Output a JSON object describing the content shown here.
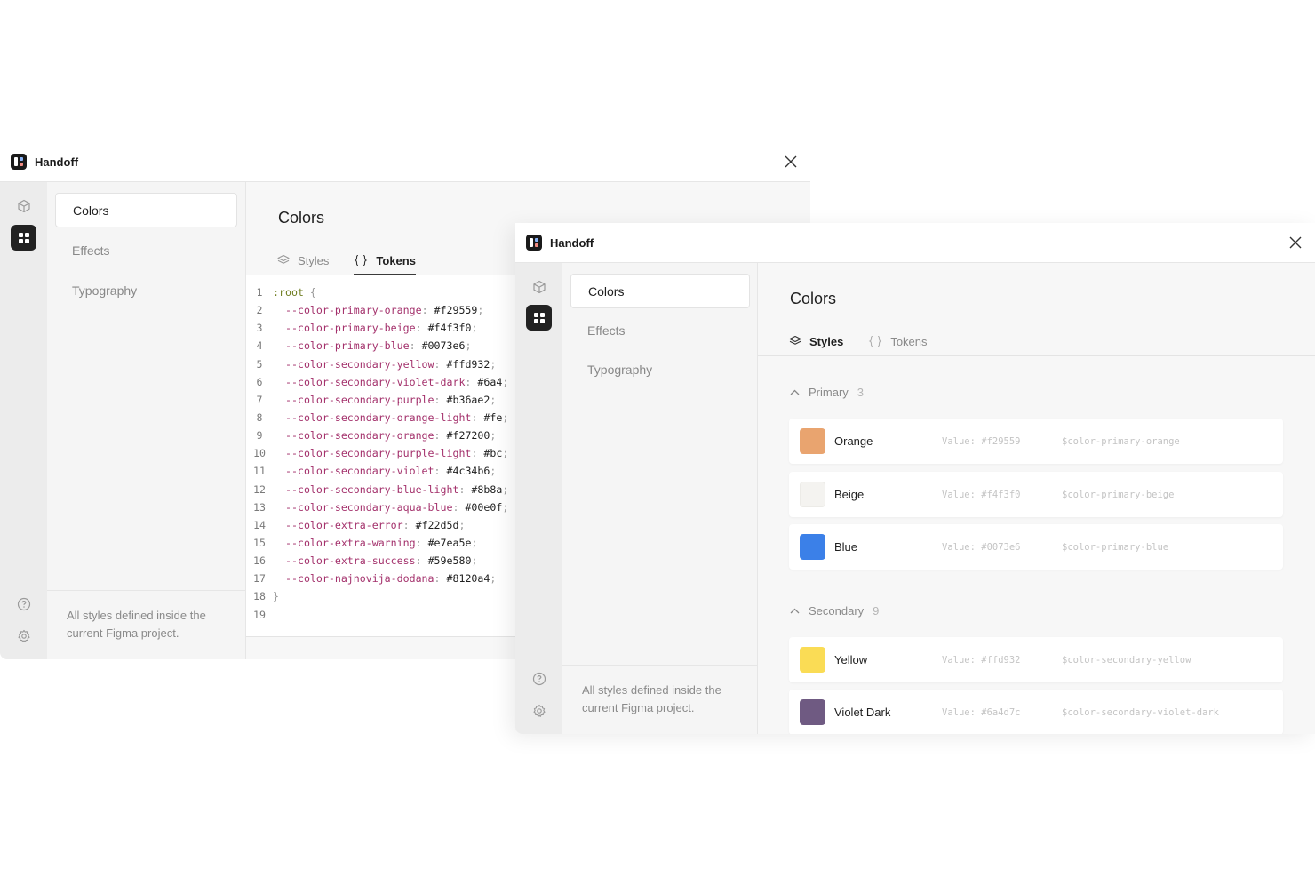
{
  "app": {
    "title": "Handoff"
  },
  "nav": {
    "items": [
      {
        "label": "Colors",
        "active": true
      },
      {
        "label": "Effects",
        "active": false
      },
      {
        "label": "Typography",
        "active": false
      }
    ],
    "footer": "All styles defined inside the current Figma project."
  },
  "main": {
    "title": "Colors",
    "tabs": [
      {
        "label": "Styles",
        "icon": "layers-icon"
      },
      {
        "label": "Tokens",
        "icon": "braces-icon"
      }
    ]
  },
  "code": {
    "line_numbers": [
      "1",
      "2",
      "3",
      "4",
      "5",
      "6",
      "7",
      "8",
      "9",
      "10",
      "11",
      "12",
      "13",
      "14",
      "15",
      "16",
      "17",
      "18",
      "19"
    ],
    "selector": ":root",
    "open": "{",
    "close": "}",
    "tokens": [
      {
        "prop": "--color-primary-orange",
        "value": "#f29559"
      },
      {
        "prop": "--color-primary-beige",
        "value": "#f4f3f0"
      },
      {
        "prop": "--color-primary-blue",
        "value": "#0073e6"
      },
      {
        "prop": "--color-secondary-yellow",
        "value": "#ffd932"
      },
      {
        "prop": "--color-secondary-violet-dark",
        "value": "#6a4"
      },
      {
        "prop": "--color-secondary-purple",
        "value": "#b36ae2"
      },
      {
        "prop": "--color-secondary-orange-light",
        "value": "#fe"
      },
      {
        "prop": "--color-secondary-orange",
        "value": "#f27200"
      },
      {
        "prop": "--color-secondary-purple-light",
        "value": "#bc"
      },
      {
        "prop": "--color-secondary-violet",
        "value": "#4c34b6"
      },
      {
        "prop": "--color-secondary-blue-light",
        "value": "#8b8a"
      },
      {
        "prop": "--color-secondary-aqua-blue",
        "value": "#00e0f"
      },
      {
        "prop": "--color-extra-error",
        "value": "#f22d5d"
      },
      {
        "prop": "--color-extra-warning",
        "value": "#e7ea5e"
      },
      {
        "prop": "--color-extra-success",
        "value": "#59e580"
      },
      {
        "prop": "--color-najnovija-dodana",
        "value": "#8120a4"
      }
    ]
  },
  "styles": {
    "groups": [
      {
        "name": "Primary",
        "count": "3",
        "colors": [
          {
            "name": "Orange",
            "value": "Value: #f29559",
            "var": "$color-primary-orange",
            "swatch": "#e9a46f"
          },
          {
            "name": "Beige",
            "value": "Value: #f4f3f0",
            "var": "$color-primary-beige",
            "swatch": "#f4f3f0"
          },
          {
            "name": "Blue",
            "value": "Value: #0073e6",
            "var": "$color-primary-blue",
            "swatch": "#3b80e8"
          }
        ]
      },
      {
        "name": "Secondary",
        "count": "9",
        "colors": [
          {
            "name": "Yellow",
            "value": "Value: #ffd932",
            "var": "$color-secondary-yellow",
            "swatch": "#fadc55"
          },
          {
            "name": "Violet Dark",
            "value": "Value: #6a4d7c",
            "var": "$color-secondary-violet-dark",
            "swatch": "#6f5a82"
          }
        ]
      }
    ]
  },
  "colors": {
    "rail_active": "#222222",
    "code_selector": "#6f7d21",
    "code_property": "#a3306b"
  }
}
